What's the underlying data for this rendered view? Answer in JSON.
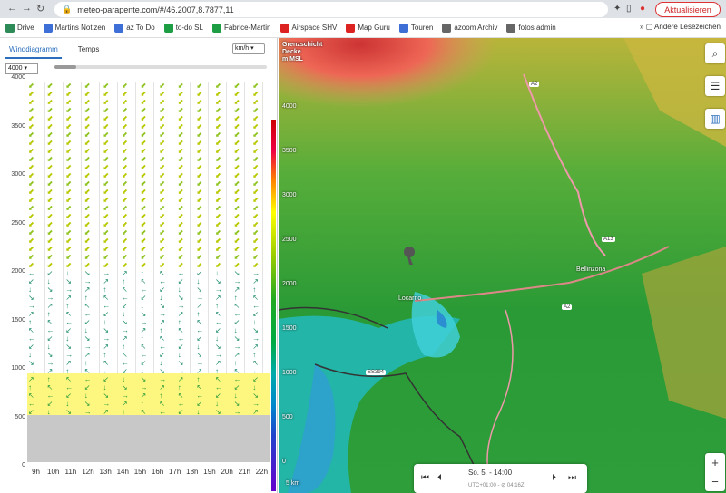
{
  "browser": {
    "url": "meteo-parapente.com/#/46.2007,8.7877,11",
    "update_label": "Aktualisieren",
    "other_bookmarks": "Andere Lesezeichen",
    "more": "»"
  },
  "bookmarks": [
    {
      "label": "Drive",
      "color": "#2e8b57"
    },
    {
      "label": "Martins Notizen",
      "color": "#3d6fd6"
    },
    {
      "label": "az To Do",
      "color": "#3d6fd6"
    },
    {
      "label": "to-do SL",
      "color": "#1e9e44"
    },
    {
      "label": "Fabrice-Martin",
      "color": "#1e9e44"
    },
    {
      "label": "Airspace SHV",
      "color": "#d22"
    },
    {
      "label": "Map Guru",
      "color": "#d22"
    },
    {
      "label": "Touren",
      "color": "#3d6fd6"
    },
    {
      "label": "azoom Archiv",
      "color": "#666"
    },
    {
      "label": "fotos admin",
      "color": "#666"
    }
  ],
  "panel": {
    "tabs": [
      "Winddiagramm",
      "Temps"
    ],
    "unit": "km/h",
    "altitude": "4000",
    "y_ticks": [
      "4000",
      "3500",
      "3000",
      "2500",
      "2000",
      "1500",
      "1000",
      "500",
      "0"
    ],
    "x_labels": [
      "9h",
      "10h",
      "11h",
      "12h",
      "13h",
      "14h",
      "15h",
      "16h",
      "17h",
      "18h",
      "19h",
      "20h",
      "21h",
      "22h"
    ]
  },
  "map": {
    "legend": [
      "Grenzschicht",
      "Decke",
      "m MSL"
    ],
    "scale": [
      "4000",
      "3500",
      "3000",
      "2500",
      "2000",
      "1500",
      "1000",
      "500",
      "0"
    ],
    "labels": [
      "Bellinzona",
      "Locarno",
      "A2",
      "A13",
      "SS394"
    ],
    "time": "So. 5. - 14:00",
    "utc": "UTC+01:00 - ⊘ 04:16Z",
    "scale_bar": "5 km"
  },
  "icons": [
    "search-icon",
    "sliders-icon",
    "bar-chart-icon",
    "plus-icon",
    "minus-icon",
    "skip-back-icon",
    "step-back-icon",
    "step-forward-icon",
    "skip-forward-icon"
  ]
}
